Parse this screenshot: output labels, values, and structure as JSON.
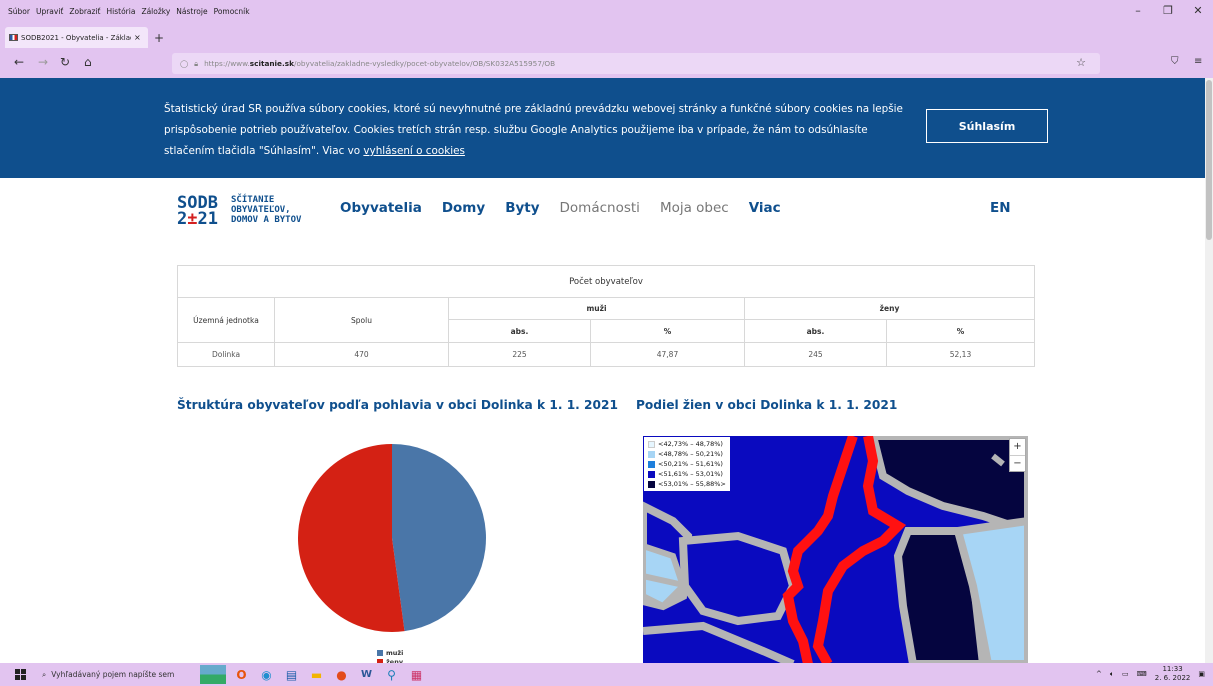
{
  "browser": {
    "menus": [
      "Súbor",
      "Upraviť",
      "Zobraziť",
      "História",
      "Záložky",
      "Nástroje",
      "Pomocník"
    ],
    "tab_title": "SODB2021 - Obyvatelia - Základ",
    "tab_close": "×",
    "new_tab": "+",
    "url_prefix": "https://www.",
    "url_domain": "scitanie.sk",
    "url_path": "/obyvatelia/zakladne-vysledky/pocet-obyvatelov/OB/SK032A515957/OB"
  },
  "cookie": {
    "text": "Štatistický úrad SR používa súbory cookies, ktoré sú nevyhnutné pre základnú prevádzku webovej stránky a funkčné súbory cookies na lepšie prispôsobenie potrieb používateľov. Cookies tretích strán resp. službu Google Analytics použijeme iba v prípade, že nám to odsúhlasíte stlačením tlačidla \"Súhlasím\". Viac vo",
    "link": "vyhlásení o cookies",
    "agree": "Súhlasím"
  },
  "site": {
    "logo_line1a": "SODB",
    "logo_line1b_pre": "2",
    "logo_line1b_mid": "±",
    "logo_line1b_post": "21",
    "logo_text1": "SČÍTANIE",
    "logo_text2": "OBYVATEĽOV,",
    "logo_text3": "DOMOV A BYTOV",
    "nav": [
      "Obyvatelia",
      "Domy",
      "Byty",
      "Domácnosti",
      "Moja obec",
      "Viac"
    ],
    "lang": "EN"
  },
  "table": {
    "caption": "Počet obyvateľov",
    "col_unit": "Územná jednotka",
    "col_total": "Spolu",
    "col_men": "muži",
    "col_women": "ženy",
    "sub_abs": "abs.",
    "sub_pct": "%",
    "row": {
      "unit": "Dolinka",
      "total": "470",
      "men_abs": "225",
      "men_pct": "47,87",
      "women_abs": "245",
      "women_pct": "52,13"
    }
  },
  "sections": {
    "pie_title": "Štruktúra obyvateľov podľa pohlavia v obci Dolinka k 1. 1. 2021",
    "map_title": "Podiel žien v obci Dolinka k 1. 1. 2021"
  },
  "chart_data": {
    "type": "pie",
    "categories": [
      "muži",
      "ženy"
    ],
    "values": [
      225,
      245
    ],
    "colors": [
      "#4a76a8",
      "#d42114"
    ]
  },
  "map_legend": [
    {
      "label": "<42,73% – 48,78%)",
      "color": "#e6f6ff"
    },
    {
      "label": "<48,78% – 50,21%)",
      "color": "#a7d5f5"
    },
    {
      "label": "<50,21% – 51,61%)",
      "color": "#1e7fdc"
    },
    {
      "label": "<51,61% – 53,01%)",
      "color": "#0a0abf"
    },
    {
      "label": "<53,01% – 55,88%>",
      "color": "#05053f"
    }
  ],
  "map_zoom": {
    "in": "+",
    "out": "−"
  },
  "taskbar": {
    "search_placeholder": "Vyhľadávaný pojem napíšte sem",
    "time": "11:33",
    "date": "2. 6. 2022"
  }
}
